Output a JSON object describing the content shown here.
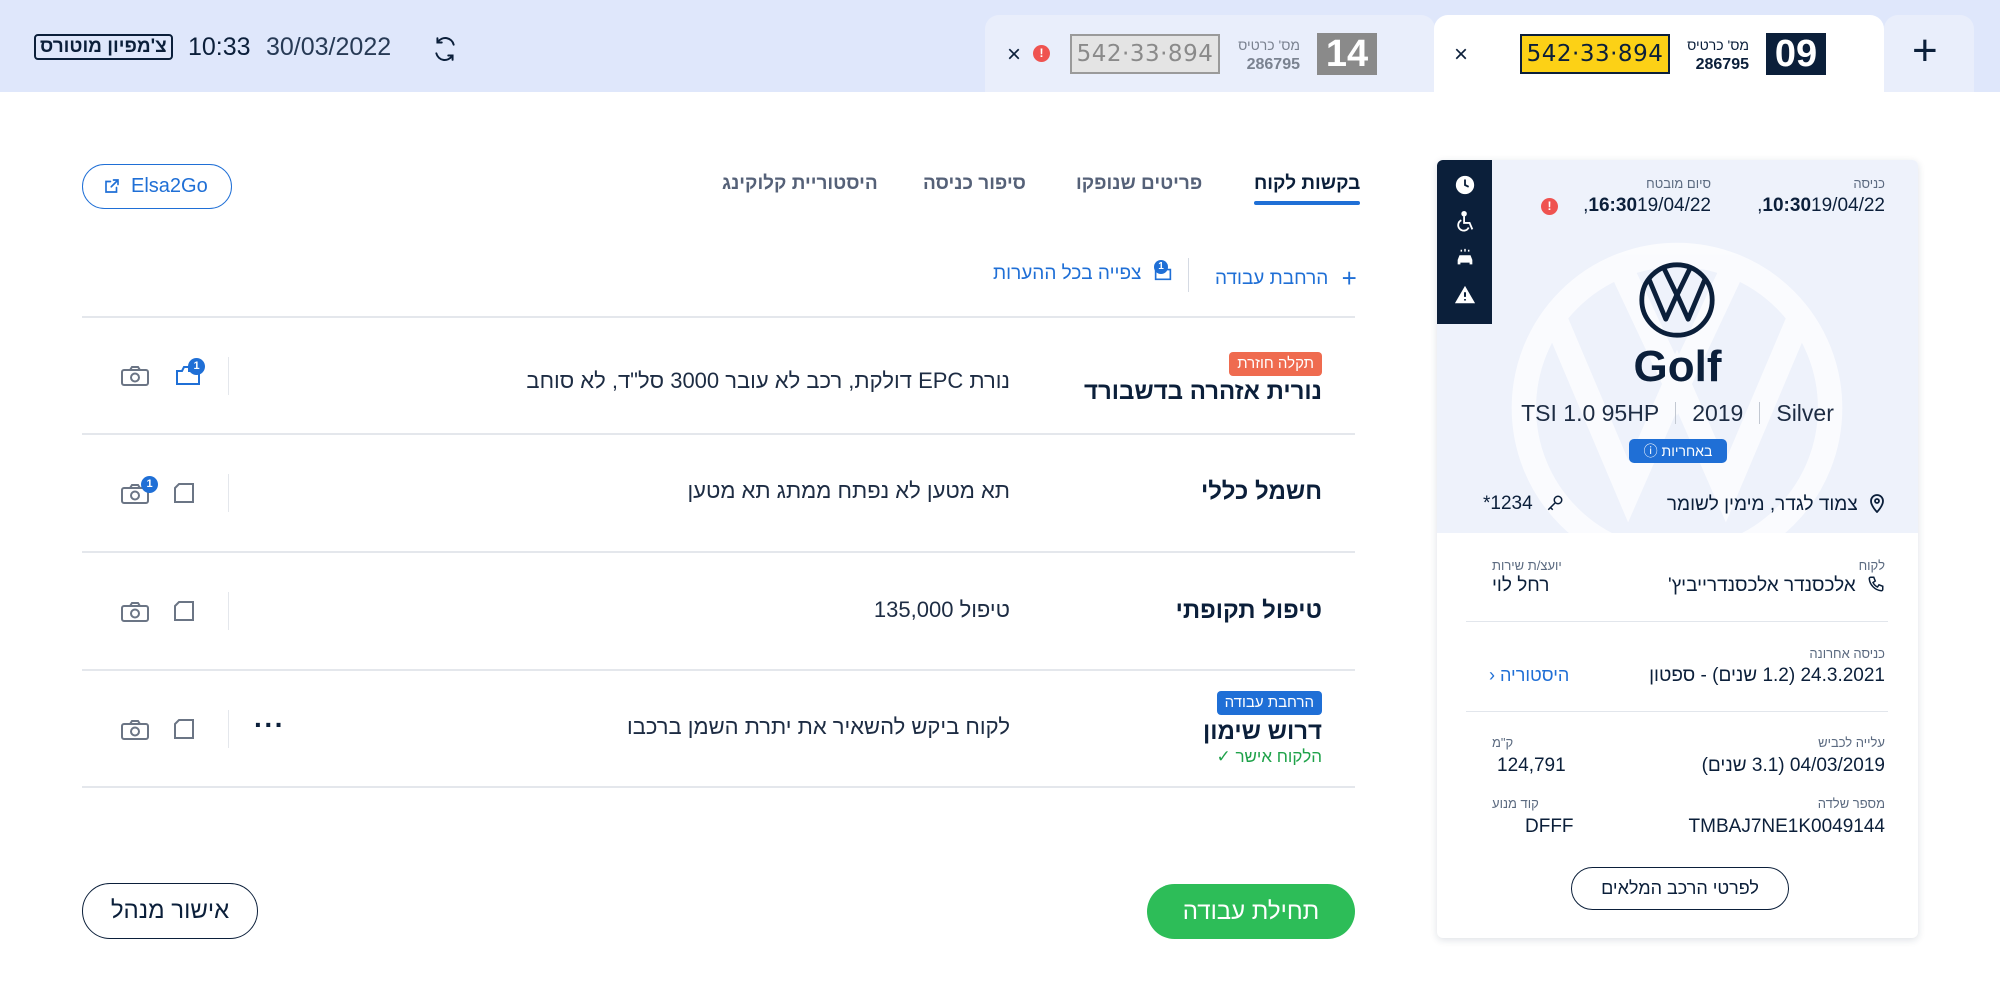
{
  "header": {
    "brand": "צ'מפיון מוטורס",
    "time": "10:33",
    "date": "30/03/2022"
  },
  "tabs": [
    {
      "number": "14",
      "card_label": "מס' כרטיס",
      "card_number": "286795",
      "plate": "542·33·894",
      "close": "×",
      "error": "!"
    },
    {
      "number": "09",
      "card_label": "מס' כרטיס",
      "card_number": "286795",
      "plate": "542·33·894",
      "close": "×"
    }
  ],
  "add_tab": "+",
  "toolbar": {
    "elsa": "Elsa2Go",
    "nav": [
      "בקשות לקוח",
      "פריטים שנופקו",
      "סיפור כניסה",
      "היסטוריית קלוקינג"
    ],
    "expand_work": "הרחבת עבודה",
    "view_comments": "צפייה בכל ההערות",
    "view_comments_count": "1"
  },
  "requests": [
    {
      "badge": "תקלה חוזרת",
      "title": "נורית אזהרה בדשבורד",
      "desc": "נורת EPC דולקת, רכב לא עובר 3000 סל\"ד, לא סוחב",
      "count": "1"
    },
    {
      "title": "חשמל כללי",
      "desc": "תא מטען לא נפתח ממתג תא מטען",
      "count": "1"
    },
    {
      "title": "טיפול תקופתי",
      "desc": "טיפול 135,000"
    },
    {
      "badge": "הרחבת עבודה",
      "title": "דרוש שימון",
      "desc": "לקוח ביקש להשאיר את יתרת השמן ברכבו",
      "approved": "הלקוח אישר",
      "more": "···"
    }
  ],
  "actions": {
    "start": "תחילת עבודה",
    "manager": "אישור מנהל"
  },
  "vehicle": {
    "entry_label": "כניסה",
    "entry_date": "19/04/22, ",
    "entry_time": "10:30",
    "end_label": "סיום מובטח",
    "end_date": "19/04/22, ",
    "end_time": "16:30",
    "end_alert": "!",
    "model": "Golf",
    "engine": "TSI 1.0 95HP",
    "year": "2019",
    "color": "Silver",
    "warranty": "באחריות",
    "location": "צמוד לגדר, מימין לשומר",
    "key": "*1234",
    "customer_label": "לקוח",
    "customer": "אלכסנדר אלכסנדרייביץ'",
    "advisor_label": "יועצ/ת שירות",
    "advisor": "רחל לוי",
    "last_entry_label": "כניסה אחרונה",
    "last_entry": "24.3.2021 (1.2 שנים) - ספטון",
    "history": "היסטוריה",
    "road_label": "עלייה לכביש",
    "road": "04/03/2019 (3.1 שנים)",
    "km_label": "ק\"מ",
    "km": "124,791",
    "chassis_label": "מספר שלדה",
    "chassis": "TMBAJ7NE1K0049144",
    "engine_code_label": "קוד מנוע",
    "engine_code": "DFFF",
    "full_details": "לפרטי הרכב המלאים"
  },
  "colors": {
    "accent": "#1f6fd6",
    "success": "#2dbd58",
    "danger": "#ef5350",
    "navy": "#0b1f3a",
    "plate_yellow": "#fcd116"
  }
}
